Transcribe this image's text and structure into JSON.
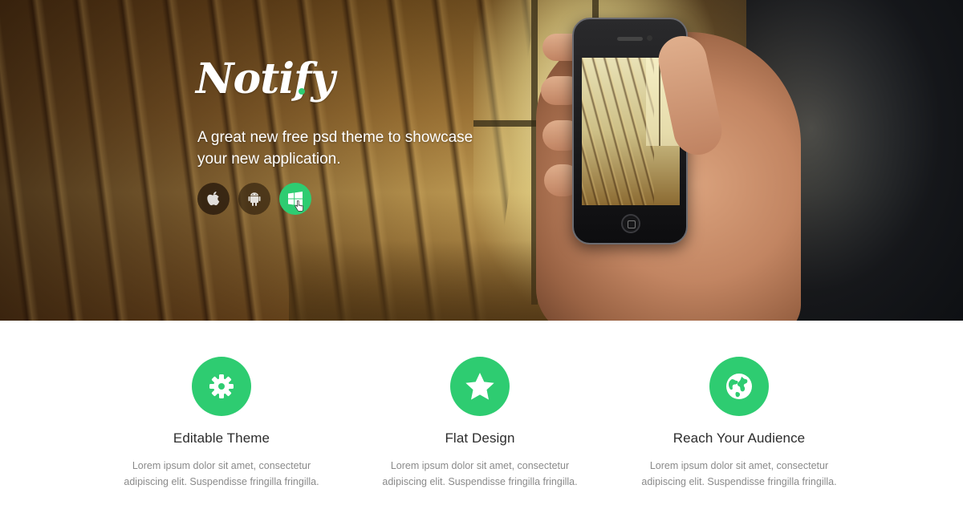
{
  "hero": {
    "logo_text": "Notify",
    "tagline_line1": "A great new free psd theme to showcase",
    "tagline_line2": "your new application.",
    "store_buttons": [
      {
        "icon": "apple-icon"
      },
      {
        "icon": "android-icon"
      },
      {
        "icon": "windows-icon"
      }
    ],
    "accent_color": "#2ecc71"
  },
  "features": [
    {
      "icon": "gear-icon",
      "title": "Editable Theme",
      "desc_line1": "Lorem ipsum dolor sit amet, consectetur",
      "desc_line2": "adipiscing elit. Suspendisse fringilla fringilla."
    },
    {
      "icon": "star-icon",
      "title": "Flat Design",
      "desc_line1": "Lorem ipsum dolor sit amet, consectetur",
      "desc_line2": "adipiscing elit. Suspendisse fringilla fringilla."
    },
    {
      "icon": "globe-icon",
      "title": "Reach Your Audience",
      "desc_line1": "Lorem ipsum dolor sit amet, consectetur",
      "desc_line2": "adipiscing elit. Suspendisse fringilla fringilla."
    }
  ]
}
